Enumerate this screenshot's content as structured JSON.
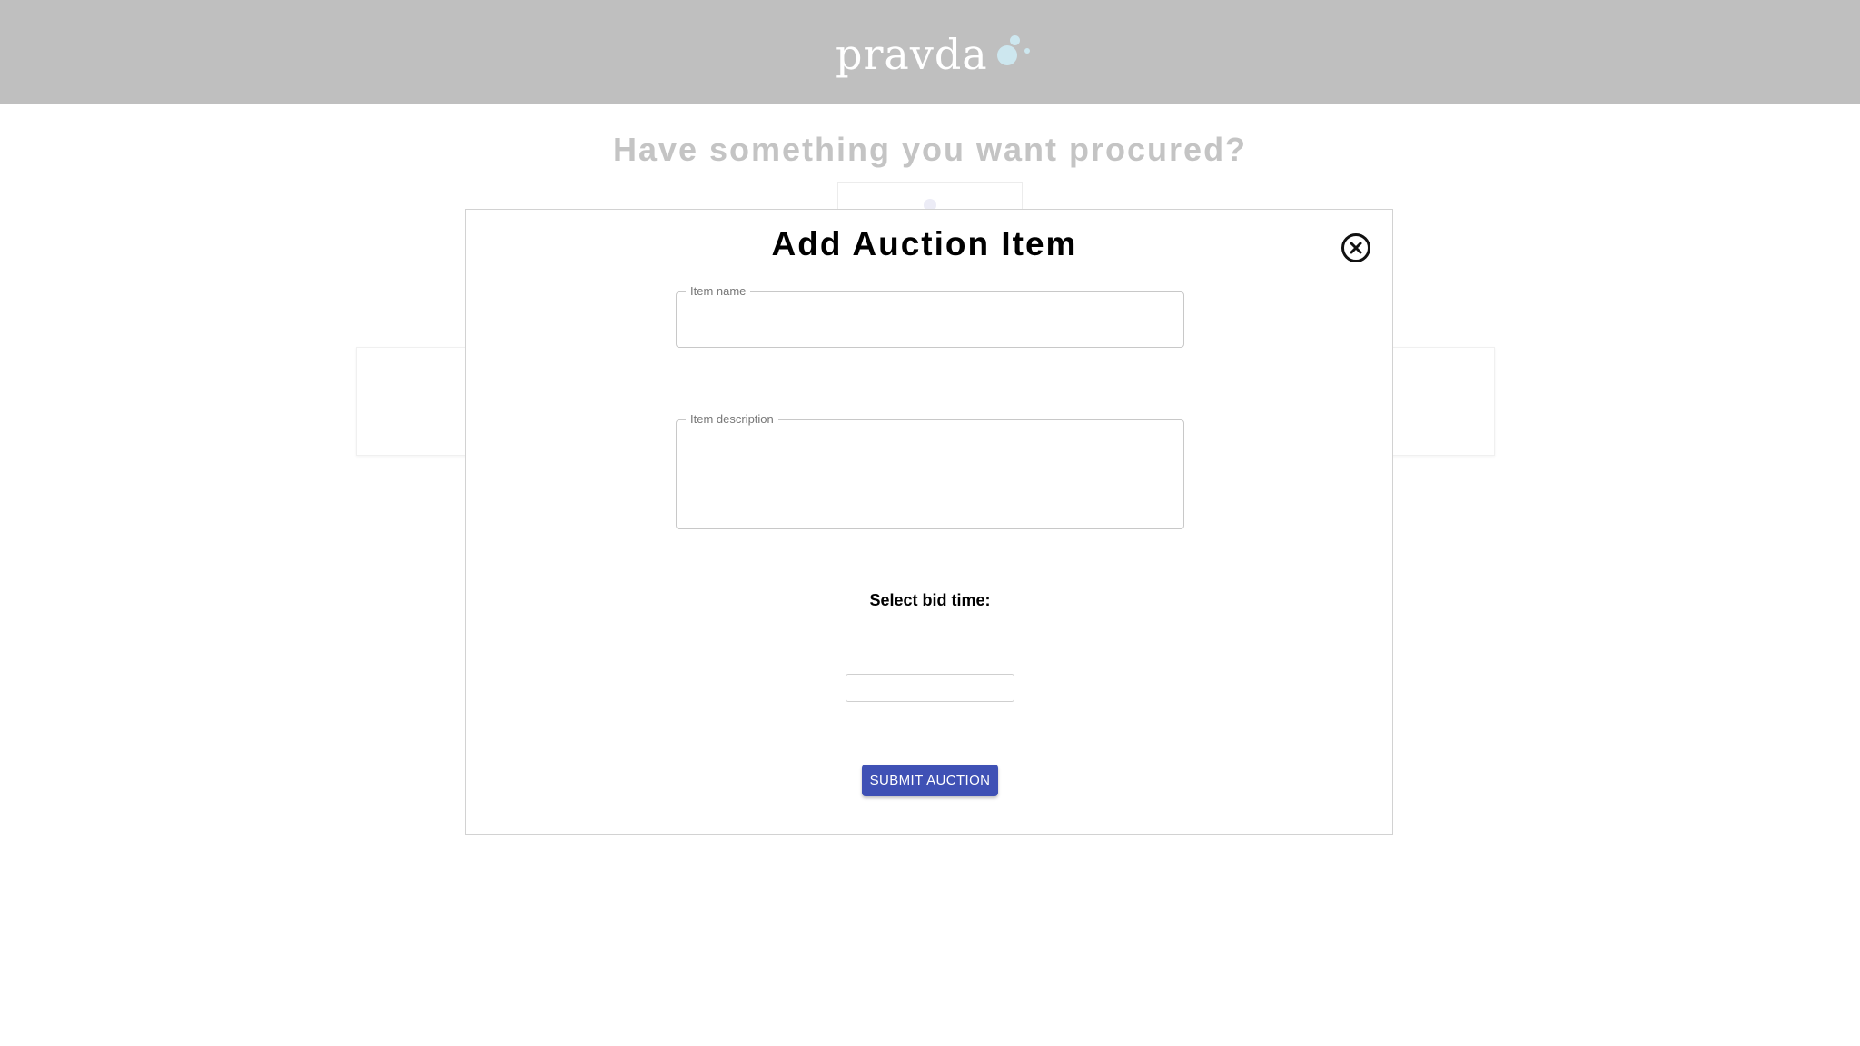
{
  "header": {
    "logo_text": "pravda",
    "logo_dots_color": "#cde7ef",
    "background_color": "#bfbfbf"
  },
  "background_page": {
    "heading": "Have something you want procured?",
    "upload_icon": "upload-icon"
  },
  "modal": {
    "title": "Add Auction Item",
    "close_icon": "close-circle-icon",
    "item_name": {
      "label": "Item name",
      "value": ""
    },
    "item_description": {
      "label": "Item description",
      "value": ""
    },
    "bid_time": {
      "label": "Select bid time:",
      "value": ""
    },
    "submit_label": "SUBMIT AUCTION",
    "submit_color": "#3f51b5"
  }
}
